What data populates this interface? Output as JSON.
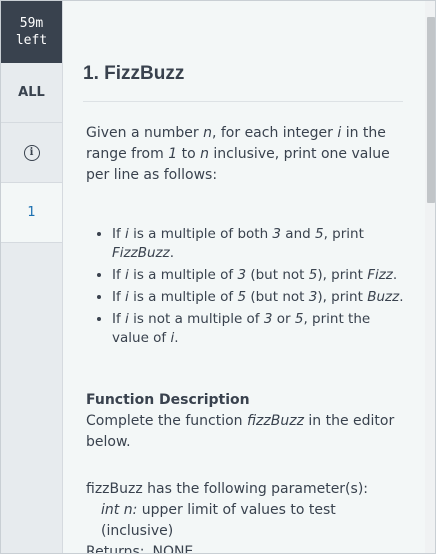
{
  "timer": {
    "line1": "59m",
    "line2": "left"
  },
  "sidebar": {
    "all_label": "ALL",
    "info_icon": "info-icon",
    "question_label": "1"
  },
  "problem": {
    "title": "1. FizzBuzz",
    "intro": {
      "p1": "Given a number ",
      "n": "n",
      "p2": ", for each integer ",
      "i": "i",
      "p3": " in the range from ",
      "one": "1",
      "p4": " to ",
      "n2": "n",
      "p5": " inclusive, print one value per line as follows:"
    },
    "rules": [
      {
        "a": "If ",
        "i": "i",
        "b": " is a multiple of both ",
        "x": "3",
        "c": " and ",
        "y": "5",
        "d": ", print ",
        "out": "FizzBuzz",
        "e": "."
      },
      {
        "a": "If ",
        "i": "i",
        "b": " is a multiple of ",
        "x": "3",
        "c": " (but not ",
        "y": "5",
        "d": "), print ",
        "out": "Fizz",
        "e": "."
      },
      {
        "a": "If ",
        "i": "i",
        "b": " is a multiple of ",
        "x": "5",
        "c": " (but not ",
        "y": "3",
        "d": "), print ",
        "out": "Buzz",
        "e": "."
      },
      {
        "a": "If ",
        "i": "i",
        "b": " is not a multiple of ",
        "x": "3",
        "c": " or ",
        "y": "5",
        "d": ", print the value of ",
        "out": "i",
        "e": "."
      }
    ],
    "function_description": {
      "heading": "Function Description",
      "p1": "Complete the function ",
      "fn": "fizzBuzz",
      "p2": " in the editor below."
    },
    "params": {
      "heading": "fizzBuzz has the following parameter(s):",
      "param_name": "int n:",
      "param_desc": " upper limit of values to test (inclusive)",
      "returns_label": "Returns:",
      "returns_value": "NONE"
    }
  },
  "colors": {
    "timer_bg": "#39424e",
    "active_question": "#1a6fb0",
    "text": "#39424e"
  }
}
